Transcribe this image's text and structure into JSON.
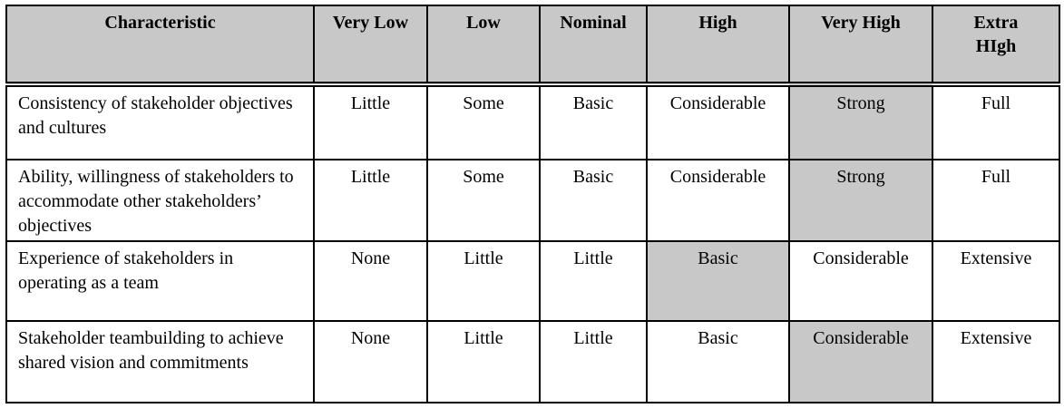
{
  "table": {
    "headers": [
      "Characteristic",
      "Very Low",
      "Low",
      "Nominal",
      "High",
      "Very High",
      "Extra HIgh"
    ],
    "rows": [
      {
        "cells": [
          "Consistency of stakeholder objectives and cultures",
          "Little",
          "Some",
          "Basic",
          "Considerable",
          "Strong",
          "Full"
        ],
        "highlight": "Very High"
      },
      {
        "cells": [
          "Ability, willingness of stakeholders to accommodate other stakeholders’ objectives",
          "Little",
          "Some",
          "Basic",
          "Considerable",
          "Strong",
          "Full"
        ],
        "highlight": "Very High"
      },
      {
        "cells": [
          "Experience of stakeholders in operating as a team",
          "None",
          "Little",
          "Little",
          "Basic",
          "Considerable",
          "Extensive"
        ],
        "highlight": "High"
      },
      {
        "cells": [
          "Stakeholder teambuilding to achieve shared vision and commitments",
          "None",
          "Little",
          "Little",
          "Basic",
          "Considerable",
          "Extensive"
        ],
        "highlight": "Very High"
      }
    ],
    "highlight_color": "#c8c8c8"
  }
}
